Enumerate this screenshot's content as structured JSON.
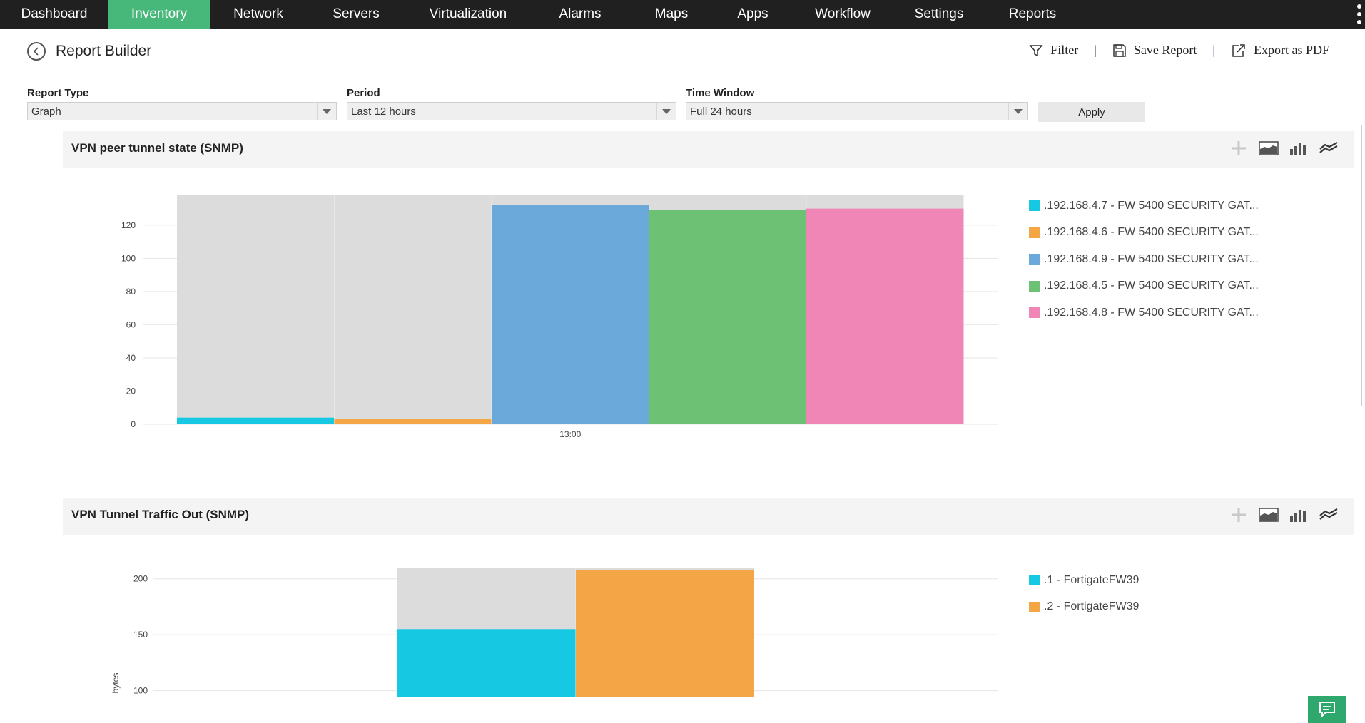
{
  "nav": {
    "items": [
      {
        "label": "Dashboard",
        "active": false
      },
      {
        "label": "Inventory",
        "active": true
      },
      {
        "label": "Network",
        "active": false
      },
      {
        "label": "Servers",
        "active": false
      },
      {
        "label": "Virtualization",
        "active": false
      },
      {
        "label": "Alarms",
        "active": false
      },
      {
        "label": "Maps",
        "active": false
      },
      {
        "label": "Apps",
        "active": false
      },
      {
        "label": "Workflow",
        "active": false
      },
      {
        "label": "Settings",
        "active": false
      },
      {
        "label": "Reports",
        "active": false
      }
    ],
    "active_color": "#47b77a",
    "bg_color": "#202020"
  },
  "header": {
    "title": "Report Builder",
    "filter_label": "Filter",
    "save_label": "Save Report",
    "export_label": "Export as PDF",
    "separator": "|"
  },
  "form": {
    "report_type": {
      "label": "Report Type",
      "value": "Graph"
    },
    "period": {
      "label": "Period",
      "value": "Last 12 hours"
    },
    "time_window": {
      "label": "Time Window",
      "value": "Full 24 hours"
    },
    "apply_label": "Apply"
  },
  "panels": [
    {
      "title": "VPN peer tunnel state (SNMP)"
    },
    {
      "title": "VPN Tunnel Traffic Out (SNMP)"
    }
  ],
  "chart_data": [
    {
      "type": "bar",
      "title": "VPN peer tunnel state (SNMP)",
      "xlabel": "",
      "ylabel": "",
      "x_tick": "13:00",
      "yticks": [
        0,
        20,
        40,
        60,
        80,
        100,
        120
      ],
      "ylim": [
        0,
        138
      ],
      "background_max": 138,
      "series": [
        {
          "name": ".192.168.4.7 - FW 5400 SECURITY GAT...",
          "value": 4,
          "color": "#16c8e2"
        },
        {
          "name": ".192.168.4.6 - FW 5400 SECURITY GAT...",
          "value": 3,
          "color": "#f4a646"
        },
        {
          "name": ".192.168.4.9 - FW 5400 SECURITY GAT...",
          "value": 132,
          "color": "#6aa9da"
        },
        {
          "name": ".192.168.4.5 - FW 5400 SECURITY GAT...",
          "value": 129,
          "color": "#6dc174"
        },
        {
          "name": ".192.168.4.8 - FW 5400 SECURITY GAT...",
          "value": 130,
          "color": "#f086b5"
        }
      ],
      "grid": true,
      "legend": "right"
    },
    {
      "type": "bar",
      "title": "VPN Tunnel Traffic Out (SNMP)",
      "xlabel": "",
      "ylabel": "bytes",
      "yticks": [
        100,
        150,
        200
      ],
      "ylim": [
        94,
        210
      ],
      "background_max": 210,
      "series": [
        {
          "name": ".1 - FortigateFW39",
          "value": 155,
          "color": "#16c8e2"
        },
        {
          "name": ".2 - FortigateFW39",
          "value": 208,
          "color": "#f4a646"
        }
      ],
      "grid": true,
      "legend": "right"
    }
  ]
}
